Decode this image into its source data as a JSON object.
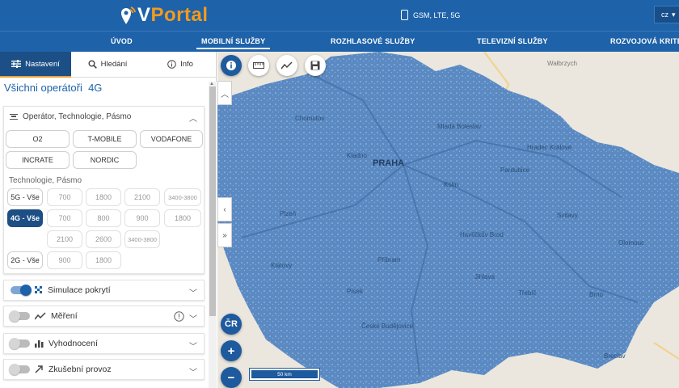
{
  "header": {
    "logo_v": "V",
    "logo_portal": "Portal",
    "network_text": "GSM, LTE, 5G",
    "lang": "cz"
  },
  "nav": {
    "items": [
      {
        "label": "ÚVOD"
      },
      {
        "label": "MOBILNÍ SLUŽBY"
      },
      {
        "label": "ROZHLASOVÉ SLUŽBY"
      },
      {
        "label": "TELEVIZNÍ SLUŽBY"
      },
      {
        "label": "ROZVOJOVÁ KRITÉR"
      }
    ],
    "active": "MOBILNÍ SLUŽBY"
  },
  "panel": {
    "tabs": [
      {
        "label": "Nastavení",
        "icon": "sliders-icon"
      },
      {
        "label": "Hledání",
        "icon": "search-icon"
      },
      {
        "label": "Info",
        "icon": "info-icon"
      }
    ],
    "operators_label": "Všichni operátoři",
    "tech_label": "4G",
    "filter_card": {
      "title": "Operátor, Technologie, Pásmo",
      "operators": [
        "O2",
        "T-MOBILE",
        "VODAFONE",
        "INCRATE",
        "NORDIC"
      ],
      "tech_band_label": "Technologie, Pásmo",
      "techs": [
        {
          "label": "5G - Vše",
          "bands": [
            "700",
            "1800",
            "2100",
            "3400-3800"
          ]
        },
        {
          "label": "4G - Vše",
          "bands": [
            "700",
            "800",
            "900",
            "1800",
            "2100",
            "2600",
            "3400-3800"
          ]
        },
        {
          "label": "2G - Vše",
          "bands": [
            "900",
            "1800"
          ]
        }
      ],
      "selected_tech": "4G - Vše"
    },
    "sections": [
      {
        "label": "Simulace pokrytí",
        "toggle": true
      },
      {
        "label": "Měření",
        "toggle": false
      },
      {
        "label": "Vyhodnocení",
        "toggle": false
      },
      {
        "label": "Zkušební provoz",
        "toggle": false
      }
    ]
  },
  "map": {
    "toolbar": [
      "info-icon",
      "ruler-icon",
      "trend-icon",
      "save-icon"
    ],
    "cr_button": "ČR",
    "zoom_in": "+",
    "zoom_out": "−",
    "scale_label": "50 km",
    "cities": [
      {
        "name": "PRAHA",
        "big": true
      },
      {
        "name": "Kladno"
      },
      {
        "name": "Kolín"
      },
      {
        "name": "Pardubice"
      },
      {
        "name": "Hradec Králové"
      },
      {
        "name": "Plzeň"
      },
      {
        "name": "Klatovy"
      },
      {
        "name": "Písek"
      },
      {
        "name": "Příbram"
      },
      {
        "name": "Jihlava"
      },
      {
        "name": "České Budějovice"
      },
      {
        "name": "Třebíč"
      },
      {
        "name": "Brno"
      },
      {
        "name": "Havlíčkův Brod"
      },
      {
        "name": "Svitavy"
      },
      {
        "name": "Olomouc"
      },
      {
        "name": "Wałbrzych",
        "outside": true
      },
      {
        "name": "Chomutov"
      },
      {
        "name": "Mladá Boleslav"
      },
      {
        "name": "Breclav"
      }
    ],
    "coverage_color": "#5b8ac3"
  }
}
